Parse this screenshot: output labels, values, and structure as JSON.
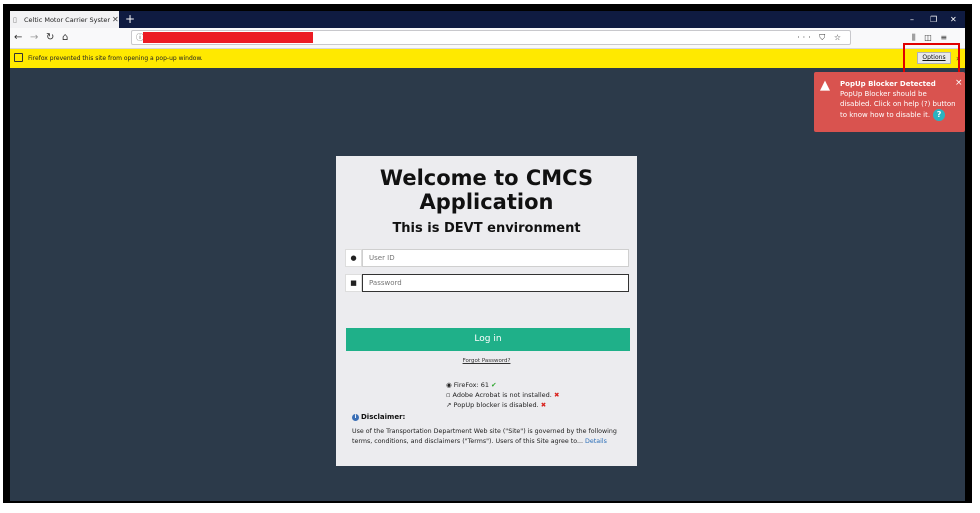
{
  "browser": {
    "tab_title": "Celtic Motor Carrier System - L",
    "tab_close": "✕",
    "new_tab": "+",
    "url_actions": "··· ⛉ ☆",
    "toolbar_right": "⫼ ◫ ≡",
    "window_controls": {
      "minimize": "–",
      "restore": "❐",
      "close": "✕"
    }
  },
  "notification": {
    "message": "Firefox prevented this site from opening a pop-up window.",
    "options_label": "Options",
    "close": "›"
  },
  "toast": {
    "title": "PopUp Blocker Detected",
    "text": "PopUp Blocker should be disabled. Click on help (?) button to know how to disable it.",
    "help": "?",
    "close": "×"
  },
  "login": {
    "title": "Welcome to CMCS Application",
    "environment": "This is DEVT environment",
    "userid_placeholder": "User ID",
    "password_placeholder": "Password",
    "login_label": "Log in",
    "forgot_label": "Forgot Password?"
  },
  "checks": [
    {
      "text": "FireFox: 61",
      "status": "✔"
    },
    {
      "text": "Adobe Acrobat is not installed.",
      "status": "✖"
    },
    {
      "text": "PopUp blocker is disabled.",
      "status": "✖"
    }
  ],
  "disclaimer": {
    "heading": "Disclaimer:",
    "text": "Use of the Transportation Department Web site (\"Site\") is governed by the following terms, conditions, and disclaimers (\"Terms\"). Users of this Site agree to...",
    "link": "Details"
  },
  "colors": {
    "background": "#2c3a4a",
    "notification": "#ffe900",
    "toast": "#d9534f",
    "login_button": "#1fb089",
    "highlight_box": "#e00000"
  }
}
